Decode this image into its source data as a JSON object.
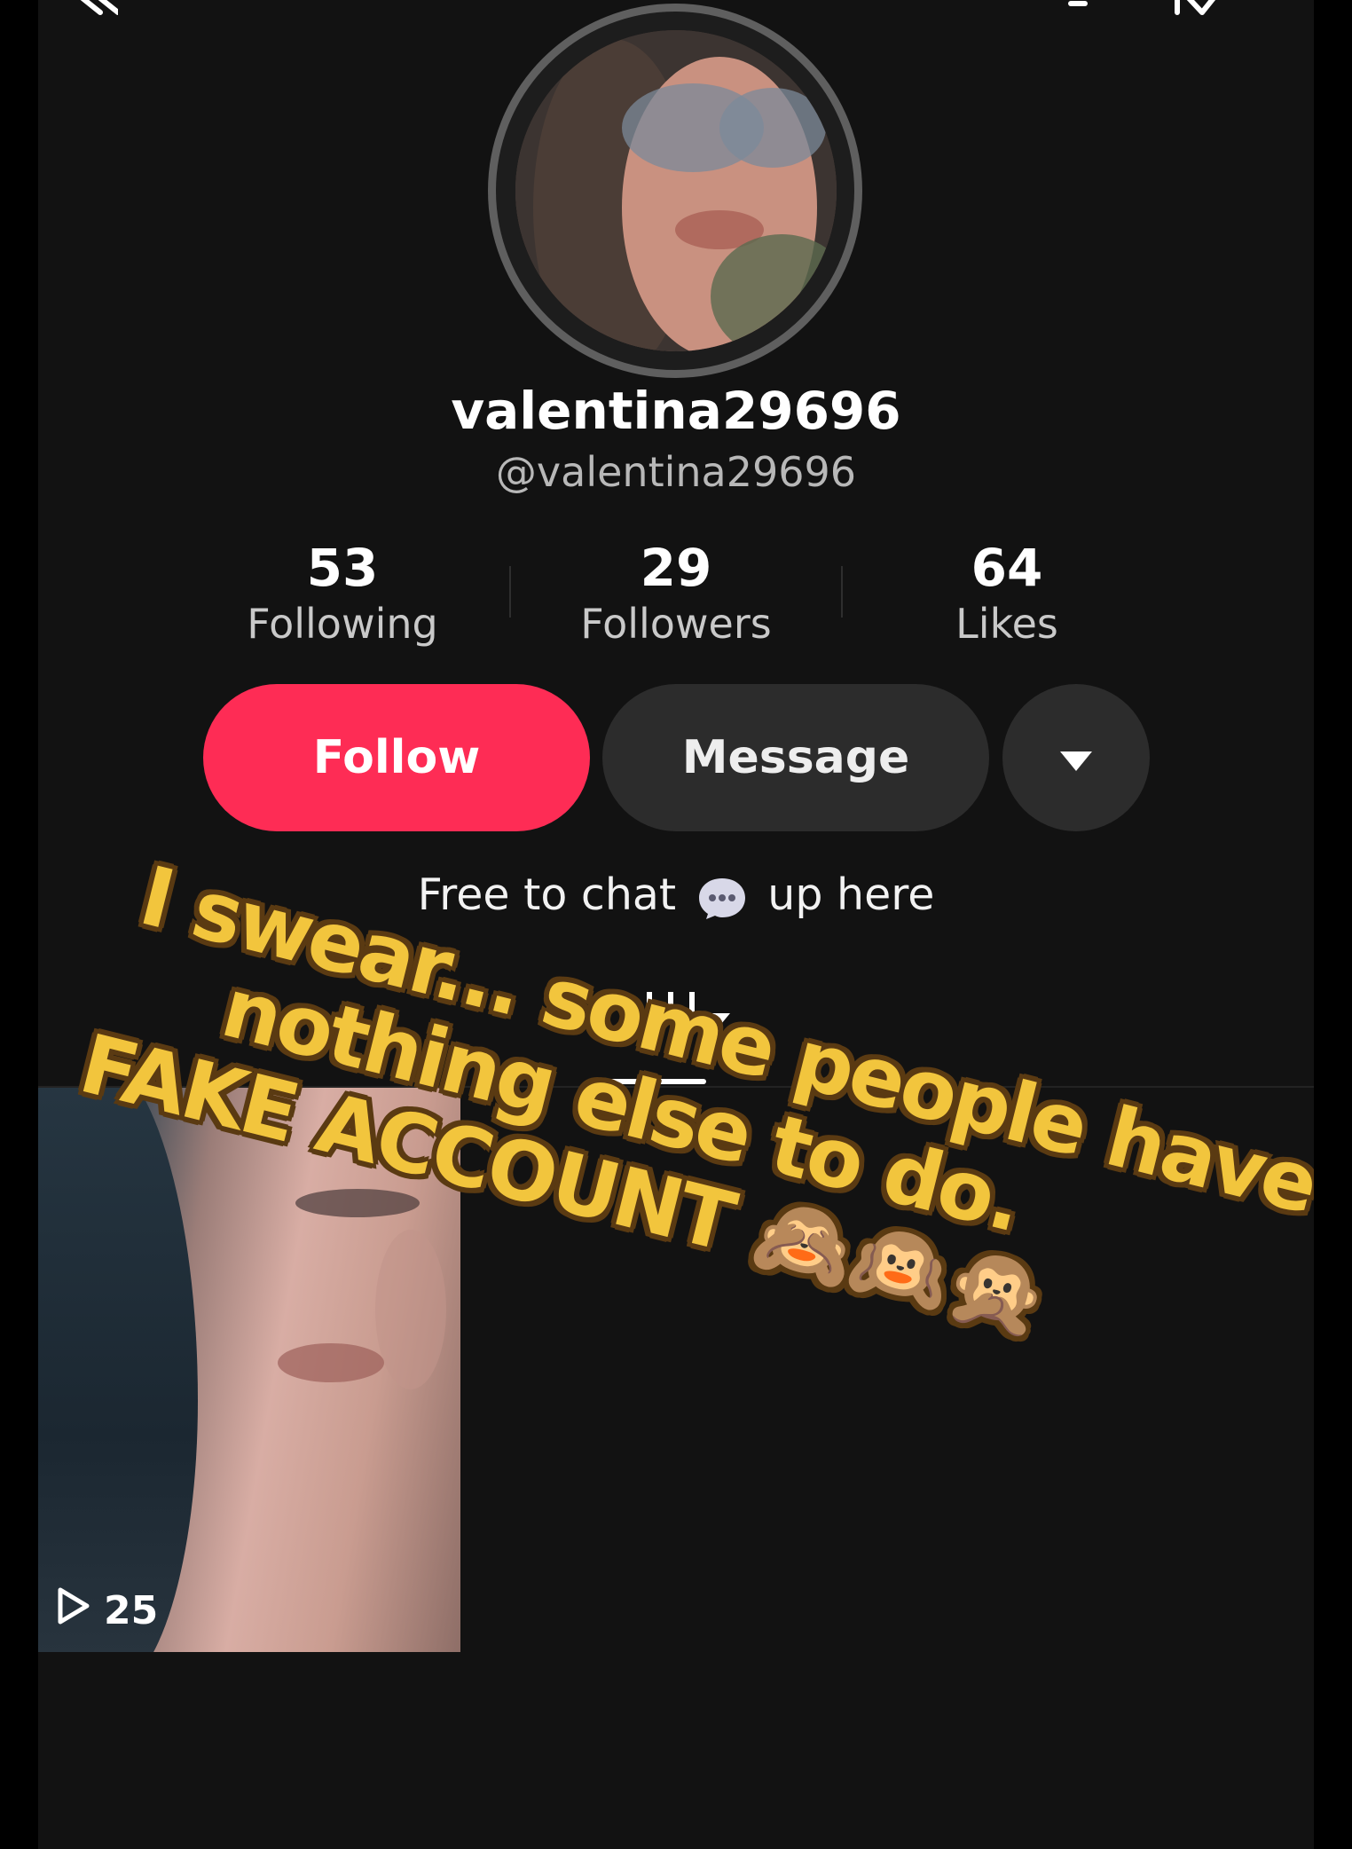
{
  "profile": {
    "display_name": "valentina29696",
    "handle": "@valentina29696",
    "bio_before": "Free to chat",
    "bio_after": "up here"
  },
  "stats": {
    "following_value": "53",
    "following_label": "Following",
    "followers_value": "29",
    "followers_label": "Followers",
    "likes_value": "64",
    "likes_label": "Likes"
  },
  "actions": {
    "follow_label": "Follow",
    "message_label": "Message"
  },
  "videos": [
    {
      "views": "25"
    }
  ],
  "overlay": {
    "line1": "I swear... some people have",
    "line2": "nothing else to do.",
    "line3": "FAKE ACCOUNT 🙈🙉🙊"
  },
  "colors": {
    "follow_button": "#fe2c55",
    "secondary_button": "#2c2c2c",
    "overlay_text": "#f2c53d"
  },
  "icons": [
    "back-icon",
    "bell-icon",
    "share-icon",
    "chevron-down-icon",
    "chat-bubble-icon",
    "grid-icon",
    "play-icon"
  ]
}
